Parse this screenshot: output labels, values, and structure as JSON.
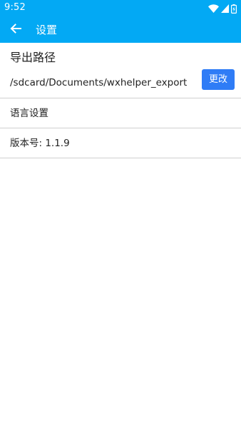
{
  "status_bar": {
    "time": "9:52",
    "icons": [
      "wifi-icon",
      "signal-icon",
      "battery-charging-icon"
    ]
  },
  "app_bar": {
    "title": "设置",
    "back_icon": "arrow-left-icon",
    "background": "#03a9f4"
  },
  "settings": {
    "export": {
      "title": "导出路径",
      "path": "/sdcard/Documents/wxhelper_export",
      "button_label": "更改",
      "button_color": "#2f7cf6"
    },
    "language": {
      "label": "语言设置"
    },
    "version": {
      "label": "版本号: 1.1.9"
    }
  }
}
